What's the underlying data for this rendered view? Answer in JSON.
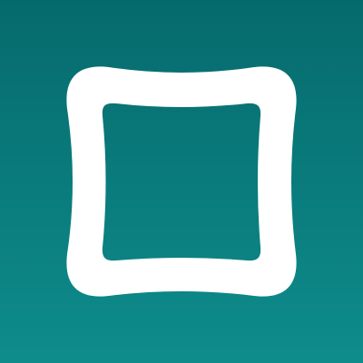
{
  "app_icon": {
    "icon_name": "rounded-square-outline-icon",
    "colors": {
      "background_top": "#066A6C",
      "background_bottom": "#0E8C8C",
      "shape_stroke": "#FFFFFF"
    }
  }
}
